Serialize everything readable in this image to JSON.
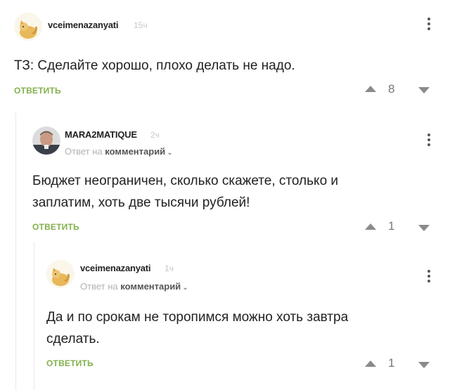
{
  "comments": [
    {
      "username": "vceimenazanyati",
      "time": "15ч",
      "text_lines": [
        "ТЗ: Сделайте хорошо, плохо делать не надо."
      ],
      "reply_label": "ОТВЕТИТЬ",
      "score": "8",
      "avatar_icon": "cat-avatar-icon"
    },
    {
      "username": "MARA2MATIQUE",
      "time": "2ч",
      "reply_to_prefix": "Ответ на",
      "reply_to_target": "комментарий",
      "text_lines": [
        "Бюджет неограничен, сколько скажете, столько и",
        "заплатим, хоть две тысячи рублей!"
      ],
      "reply_label": "ОТВЕТИТЬ",
      "score": "1",
      "avatar_icon": "man-portrait-avatar-icon"
    },
    {
      "username": "vceimenazanyati",
      "time": "1ч",
      "reply_to_prefix": "Ответ на",
      "reply_to_target": "комментарий",
      "text_lines": [
        "Да и по срокам не торопимся можно хоть завтра",
        "сделать."
      ],
      "reply_label": "ОТВЕТИТЬ",
      "score": "1",
      "avatar_icon": "cat-avatar-icon"
    }
  ],
  "colors": {
    "reply": "#83b04e",
    "meta": "#c8c8c8",
    "text": "#222222"
  }
}
